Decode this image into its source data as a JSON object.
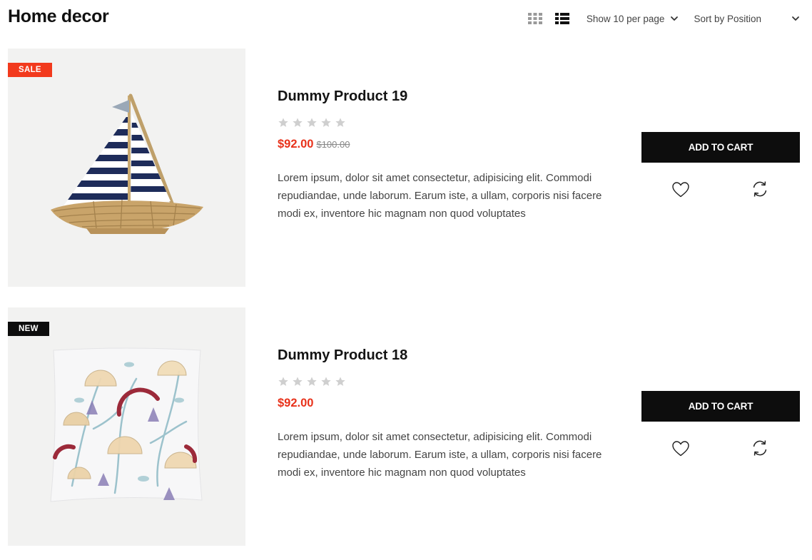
{
  "page": {
    "title": "Home decor"
  },
  "toolbar": {
    "grid_view_icon": "grid-view-icon",
    "list_view_icon": "list-view-icon",
    "per_page_label": "Show 10 per page",
    "sort_label": "Sort by Position"
  },
  "colors": {
    "sale_badge": "#f23a1d",
    "new_badge": "#0d0d0d",
    "price": "#e8321b",
    "button": "#0d0d0d",
    "star": "#cfcfcf",
    "image_bg": "#f2f2f1"
  },
  "products": [
    {
      "badge": "SALE",
      "image": "sailboat-image",
      "name": "Dummy Product 19",
      "rating": 0,
      "price": "$92.00",
      "old_price": "$100.00",
      "description": "Lorem ipsum, dolor sit amet consectetur, adipisicing elit. Commodi repudiandae, unde laborum. Earum iste, a ullam, corporis nisi facere modi ex, inventore hic magnam non quod voluptates",
      "cart_label": "ADD TO CART"
    },
    {
      "badge": "NEW",
      "image": "floral-pillow-image",
      "name": "Dummy Product 18",
      "rating": 0,
      "price": "$92.00",
      "old_price": "",
      "description": "Lorem ipsum, dolor sit amet consectetur, adipisicing elit. Commodi repudiandae, unde laborum. Earum iste, a ullam, corporis nisi facere modi ex, inventore hic magnam non quod voluptates",
      "cart_label": "ADD TO CART"
    }
  ]
}
